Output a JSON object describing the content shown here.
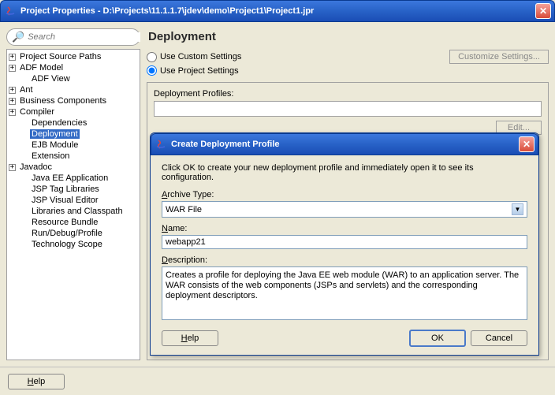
{
  "window": {
    "title": "Project Properties - D:\\Projects\\11.1.1.7\\jdev\\demo\\Project1\\Project1.jpr"
  },
  "search": {
    "placeholder": "Search"
  },
  "tree": [
    {
      "label": "Project Source Paths",
      "exp": "+",
      "indent": 1
    },
    {
      "label": "ADF Model",
      "exp": "+",
      "indent": 1
    },
    {
      "label": "ADF View",
      "exp": "",
      "indent": 2
    },
    {
      "label": "Ant",
      "exp": "+",
      "indent": 1
    },
    {
      "label": "Business Components",
      "exp": "+",
      "indent": 1
    },
    {
      "label": "Compiler",
      "exp": "+",
      "indent": 1
    },
    {
      "label": "Dependencies",
      "exp": "",
      "indent": 2
    },
    {
      "label": "Deployment",
      "exp": "",
      "indent": 2,
      "selected": true
    },
    {
      "label": "EJB Module",
      "exp": "",
      "indent": 2
    },
    {
      "label": "Extension",
      "exp": "",
      "indent": 2
    },
    {
      "label": "Javadoc",
      "exp": "+",
      "indent": 1
    },
    {
      "label": "Java EE Application",
      "exp": "",
      "indent": 2
    },
    {
      "label": "JSP Tag Libraries",
      "exp": "",
      "indent": 2
    },
    {
      "label": "JSP Visual Editor",
      "exp": "",
      "indent": 2
    },
    {
      "label": "Libraries and Classpath",
      "exp": "",
      "indent": 2
    },
    {
      "label": "Resource Bundle",
      "exp": "",
      "indent": 2
    },
    {
      "label": "Run/Debug/Profile",
      "exp": "",
      "indent": 2
    },
    {
      "label": "Technology Scope",
      "exp": "",
      "indent": 2
    }
  ],
  "right": {
    "heading": "Deployment",
    "custom": "Use Custom Settings",
    "project": "Use Project Settings",
    "customize_btn": "Customize Settings...",
    "profiles_label": "Deployment Profiles:",
    "edit_btn": "Edit..."
  },
  "bottom": {
    "help": "Help"
  },
  "dialog": {
    "title": "Create Deployment Profile",
    "message": "Click OK to create your new deployment profile and immediately open it to see its configuration.",
    "archive_label": "Archive Type:",
    "archive_value": "WAR File",
    "name_label": "Name:",
    "name_value": "webapp21",
    "desc_label": "Description:",
    "desc_text": "Creates a profile for deploying the Java EE web module (WAR) to an application server. The WAR consists of the web components (JSPs and servlets) and the corresponding deployment descriptors.",
    "help": "Help",
    "ok": "OK",
    "cancel": "Cancel"
  }
}
